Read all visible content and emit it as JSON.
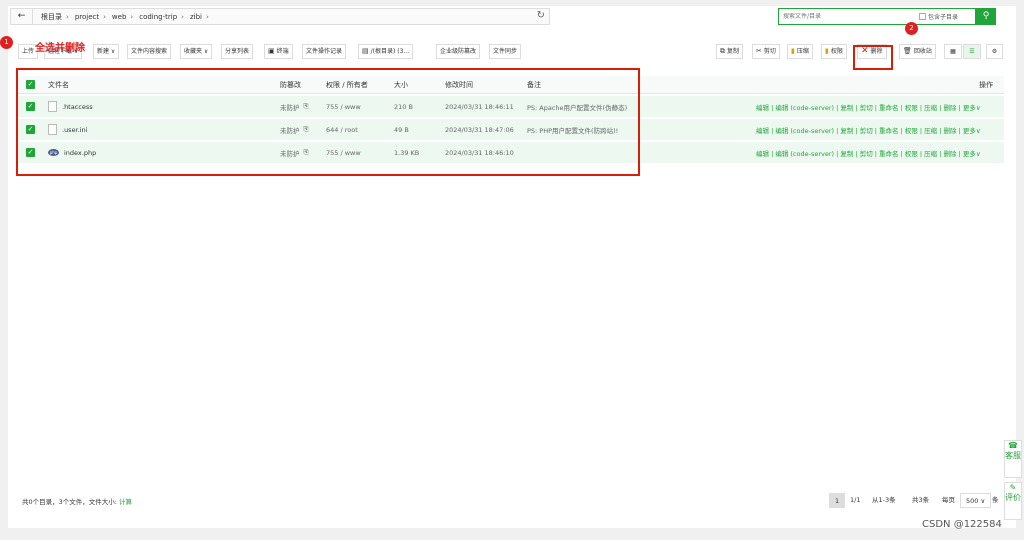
{
  "breadcrumb": [
    "根目录",
    "project",
    "web",
    "coding-trip",
    "zibi"
  ],
  "search": {
    "placeholder": "搜索文件/目录",
    "subdir_label": "包含子目录"
  },
  "toolbar_left": [
    "上传",
    "远程下载 ∨",
    "新建 ∨",
    "文件内容搜索",
    "收藏夹 ∨",
    "分享列表",
    "终端",
    "文件操作记录",
    "/(根目录) (3...",
    "企业级防篡改",
    "文件同步"
  ],
  "toolbar_right": {
    "copy": "复制",
    "cut": "剪切",
    "compress": "压缩",
    "perm": "权限",
    "delete": "删除",
    "recycle": "回收站"
  },
  "annotation": {
    "step1": "1",
    "step1_text": "全选并删除",
    "step2": "2"
  },
  "table": {
    "headers": {
      "name": "文件名",
      "protect": "防篡改",
      "perm": "权限 / 所有者",
      "size": "大小",
      "mtime": "修改时间",
      "remark": "备注",
      "ops": "操作"
    },
    "rows": [
      {
        "name": ".htaccess",
        "protect": "未防护",
        "perm": "755 / www",
        "size": "210 B",
        "mtime": "2024/03/31 18:46:11",
        "remark": "PS: Apache用户配置文件(伪静态)",
        "icon": "file-icon"
      },
      {
        "name": ".user.ini",
        "protect": "未防护",
        "perm": "644 / root",
        "size": "49 B",
        "mtime": "2024/03/31 18:47:06",
        "remark": "PS: PHP用户配置文件(防跨站)!",
        "icon": "file-icon"
      },
      {
        "name": "index.php",
        "protect": "未防护",
        "perm": "755 / www",
        "size": "1.39 KB",
        "mtime": "2024/03/31 18:46:10",
        "remark": "",
        "icon": "php-icon"
      }
    ],
    "ops_text": "编辑 | 编辑 (code-server) | 复制 | 剪切 | 重命名 | 权限 | 压缩 | 删除 | 更多∨"
  },
  "footer": {
    "summary": "共0个目录，3个文件，文件大小:",
    "calc": "计算",
    "page_current": "1",
    "page_total": "1/1",
    "range": "从1-3条",
    "count": "共3条",
    "per_page_label": "每页",
    "per_page": "500",
    "per_page_unit": "条"
  },
  "side": {
    "service": "客服",
    "review": "评价"
  },
  "watermark": "CSDN @122584",
  "colors": {
    "accent": "#20a53a",
    "annotation": "#e02020",
    "row_bg": "#edf8f0"
  }
}
